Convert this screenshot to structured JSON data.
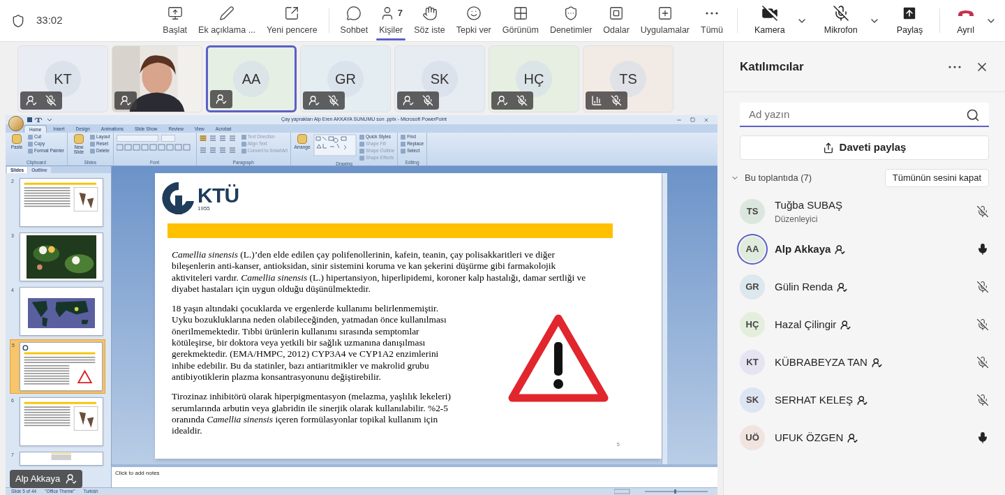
{
  "meeting": {
    "timer": "33:02"
  },
  "toolbar": [
    {
      "label": "Başlat",
      "selected": false
    },
    {
      "label": "Ek açıklama ...",
      "selected": false
    },
    {
      "label": "Yeni pencere",
      "selected": false
    },
    {
      "label": "Sohbet",
      "selected": false
    },
    {
      "label": "Kişiler",
      "count": "7",
      "selected": true
    },
    {
      "label": "Söz iste",
      "selected": false
    },
    {
      "label": "Tepki ver",
      "selected": false
    },
    {
      "label": "Görünüm",
      "selected": false
    },
    {
      "label": "Denetimler",
      "selected": false
    },
    {
      "label": "Odalar",
      "selected": false
    },
    {
      "label": "Uygulamalar",
      "selected": false
    },
    {
      "label": "Tümü",
      "selected": false
    }
  ],
  "devices": [
    {
      "kind": "camera",
      "label": "Kamera",
      "on": false
    },
    {
      "kind": "mic",
      "label": "Mikrofon",
      "on": false
    },
    {
      "kind": "share",
      "label": "Paylaş"
    },
    {
      "kind": "leave",
      "label": "Ayrıl"
    }
  ],
  "video_tiles": [
    {
      "kind": "avatar",
      "initials": "KT",
      "color": "#e9ecf3",
      "speaking": false,
      "muted": true,
      "network_issue": false
    },
    {
      "kind": "camera",
      "speaking": false,
      "muted": false,
      "network_issue": false
    },
    {
      "kind": "avatar",
      "initials": "AA",
      "color": "#e6efe4",
      "speaking": true,
      "muted": false,
      "network_issue": false
    },
    {
      "kind": "avatar",
      "initials": "GR",
      "color": "#e4edf2",
      "speaking": false,
      "muted": true,
      "network_issue": false
    },
    {
      "kind": "avatar",
      "initials": "SK",
      "color": "#e7ebf2",
      "speaking": false,
      "muted": true,
      "network_issue": false
    },
    {
      "kind": "avatar",
      "initials": "HÇ",
      "color": "#e7efe3",
      "speaking": false,
      "muted": true,
      "network_issue": false
    },
    {
      "kind": "avatar",
      "initials": "TS",
      "color": "#f2ebe5",
      "speaking": false,
      "muted": true,
      "network_issue": true
    }
  ],
  "presentation": {
    "window_title": "Çay yaprakları Alp Eren AKKAYA SUNUMU son .pptx - Microsoft PowerPoint",
    "ribbon_tabs": [
      {
        "label": "Home",
        "selected": true
      },
      {
        "label": "Insert",
        "selected": false
      },
      {
        "label": "Design",
        "selected": false
      },
      {
        "label": "Animations",
        "selected": false
      },
      {
        "label": "Slide Show",
        "selected": false
      },
      {
        "label": "Review",
        "selected": false
      },
      {
        "label": "View",
        "selected": false
      },
      {
        "label": "Acrobat",
        "selected": false
      }
    ],
    "ribbon_groups": [
      {
        "label": "Clipboard",
        "big": "Paste",
        "commands": [
          "Cut",
          "Copy",
          "Format Painter"
        ]
      },
      {
        "label": "Slides",
        "big": "New Slide",
        "commands": [
          "Layout",
          "Reset",
          "Delete"
        ]
      },
      {
        "label": "Font"
      },
      {
        "label": "Paragraph",
        "commands": [
          "Text Direction",
          "Align Text",
          "Convert to SmartArt"
        ]
      },
      {
        "label": "Drawing",
        "big": "Arrange",
        "commands": [
          "Quick Styles",
          "Shape Fill",
          "Shape Outline",
          "Shape Effects"
        ]
      },
      {
        "label": "Editing",
        "commands": [
          "Find",
          "Replace",
          "Select"
        ]
      }
    ],
    "pane_tabs": [
      {
        "label": "Slides",
        "selected": true
      },
      {
        "label": "Outline",
        "selected": false
      }
    ],
    "thumbnails": [
      {
        "number": "2",
        "kind": "text-figure",
        "selected": false
      },
      {
        "number": "3",
        "selected": false
      },
      {
        "number": "4",
        "kind": "map",
        "selected": false
      },
      {
        "number": "5",
        "kind": "current",
        "selected": true
      },
      {
        "number": "6",
        "kind": "text-figure",
        "selected": false
      },
      {
        "number": "7",
        "kind": "text",
        "selected": false
      }
    ],
    "slide": {
      "logo_text": "KTÜ",
      "logo_year": "1955",
      "paragraphs": [
        "*Camellia sinensis* (L.)’den elde edilen çay polifenollerinin, kafein, teanin, çay polisakkaritleri ve diğer bileşenlerin anti-kanser, antioksidan, sinir sistemini koruma ve kan şekerini düşürme gibi farmakolojik aktiviteleri vardır. *Camellia sinensis* (L.) hipertansiyon, hiperlipidemi, koroner kalp hastalığı, damar sertliği ve diyabet hastaları için uygun olduğu düşünülmektedir.",
        "18 yaşın altındaki çocuklarda ve ergenlerde kullanımı belirlenmemiştir. Uyku bozukluklarına neden  olabileceğinden, yatmadan önce kullanılması önerilmemektedir. Tıbbi ürünlerin kullanımı sırasında semptomlar kötüleşirse, bir doktora veya yetkili bir sağlık uzmanına danışılması gerekmektedir. (EMA/HMPC, 2012) CYP3A4 ve CYP1A2 enzimlerini inhibe edebilir. Bu da statinler, bazı antiaritmikler ve makrolid grubu antibiyotiklerin plazma konsantrasyonunu değiştirebilir.",
        "Tirozinaz inhibitörü olarak hiperpigmentasyon (melazma, yaşlılık lekeleri) serumlarında arbutin veya glabridin ile sinerjik olarak kullanılabilir. %2-5 oranında *Camellia sinensis* içeren formülasyonlar topikal kullanım için idealdir."
      ],
      "page_number": "5"
    },
    "notes_placeholder": "Click to add notes",
    "status_bar": [
      "Slide 5 of 44",
      "\"Office Theme\"",
      "Turkish"
    ]
  },
  "presenter_label": "Alp Akkaya",
  "panel": {
    "title": "Katılımcılar",
    "search": {
      "placeholder": "Ad yazın"
    },
    "invite_button": "Daveti paylaş",
    "section": {
      "label": "Bu toplantıda (7)",
      "expanded": true
    },
    "mute_all_button": "Tümünün sesini kapat",
    "participants": [
      {
        "initials": "TS",
        "name": "Tuğba SUBAŞ",
        "role": "Düzenleyici",
        "color": "#dbe7de",
        "speaking": false,
        "badge": false,
        "muted": true
      },
      {
        "initials": "AA",
        "name": "Alp Akkaya",
        "color": "#dfebdc",
        "speaking": true,
        "badge": true,
        "muted": false
      },
      {
        "initials": "GR",
        "name": "Gülin Renda",
        "color": "#dde7ee",
        "speaking": false,
        "badge": true,
        "muted": true
      },
      {
        "initials": "HÇ",
        "name": "Hazal Çilingir",
        "color": "#e3eedc",
        "speaking": false,
        "badge": true,
        "muted": true
      },
      {
        "initials": "KT",
        "name": "KÜBRABEYZA TAN",
        "color": "#e6e3f3",
        "speaking": false,
        "badge": true,
        "muted": true
      },
      {
        "initials": "SK",
        "name": "SERHAT KELEŞ",
        "color": "#dce5f1",
        "speaking": false,
        "badge": true,
        "muted": true
      },
      {
        "initials": "UÖ",
        "name": "UFUK ÖZGEN",
        "color": "#f1e4df",
        "speaking": false,
        "badge": true,
        "muted": false
      }
    ]
  }
}
